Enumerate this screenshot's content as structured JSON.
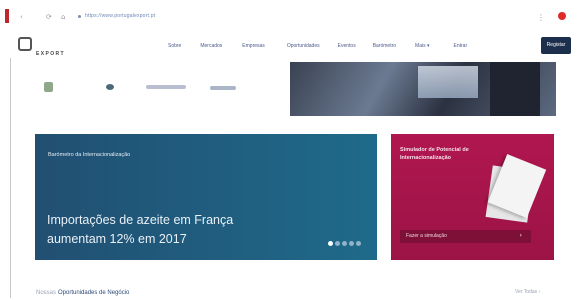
{
  "browser": {
    "back_glyph": "‹",
    "reload_glyph": "⟳",
    "home_glyph": "⌂",
    "url": "https://www.portugalexport.pt",
    "menu_glyph": "⋮"
  },
  "header": {
    "logo_text": "EXPORT",
    "nav": [
      "Sobre",
      "Mercados",
      "Empresas",
      "Oportunidades",
      "Eventos",
      "Barómetro",
      "Mais ▾",
      "Entrar"
    ],
    "login_label": "Registar"
  },
  "banner": {
    "label": "Barómetro da Internacionalização",
    "headline": "Importações de azeite em França aumentam 12% em 2017",
    "dot_count": 5,
    "active_dot": 0
  },
  "simulator": {
    "title": "Simulador de Potencial de Internacionalização",
    "button_label": "Fazer a simulação",
    "button_arrow": "›"
  },
  "section": {
    "prefix": "Nossas",
    "title": "Oportunidades de Negócio",
    "see_all": "Ver Todas ›"
  },
  "colors": {
    "banner": "#1f5d80",
    "simulator": "#a8154b",
    "login": "#1c2f4d",
    "record": "#e02a2a"
  }
}
